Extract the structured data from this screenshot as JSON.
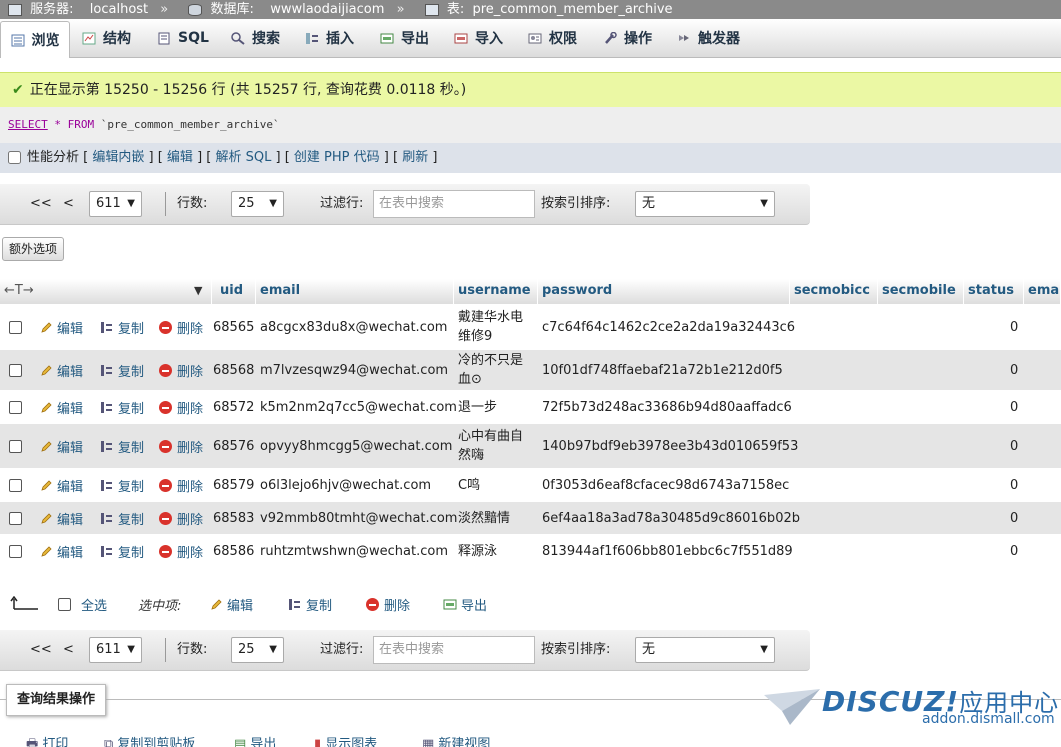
{
  "breadcrumb": {
    "server_label": "服务器:",
    "server": "localhost",
    "db_label": "数据库:",
    "db": "wwwlaodaijiacom",
    "table_label": "表:",
    "table": "pre_common_member_archive",
    "sep": "»"
  },
  "tabs": [
    {
      "label": "浏览",
      "icon": "browse-icon"
    },
    {
      "label": "结构",
      "icon": "structure-icon"
    },
    {
      "label": "SQL",
      "icon": "sql-icon"
    },
    {
      "label": "搜索",
      "icon": "search-icon"
    },
    {
      "label": "插入",
      "icon": "insert-icon"
    },
    {
      "label": "导出",
      "icon": "export-icon"
    },
    {
      "label": "导入",
      "icon": "import-icon"
    },
    {
      "label": "权限",
      "icon": "privileges-icon"
    },
    {
      "label": "操作",
      "icon": "operations-icon"
    },
    {
      "label": "触发器",
      "icon": "triggers-icon"
    }
  ],
  "notice": "正在显示第 15250 - 15256 行 (共 15257 行, 查询花费 0.0118 秒。)",
  "sql": {
    "select": "SELECT",
    "star": "*",
    "from": "FROM",
    "table": "`pre_common_member_archive`"
  },
  "actions": {
    "profiling": "性能分析",
    "edit_inline": "编辑内嵌",
    "edit": "编辑",
    "explain": "解析 SQL",
    "create_php": "创建 PHP 代码",
    "refresh": "刷新"
  },
  "nav": {
    "first": "<<",
    "prev": "<",
    "page": "611",
    "rows_label": "行数:",
    "rows": "25",
    "filter_label": "过滤行:",
    "filter_placeholder": "在表中搜索",
    "sort_label": "按索引排序:",
    "sort": "无"
  },
  "extra_options": "额外选项",
  "columns": [
    "uid",
    "email",
    "username",
    "password",
    "secmobicc",
    "secmobile",
    "status",
    "emai"
  ],
  "row_actions": {
    "edit": "编辑",
    "copy": "复制",
    "delete": "删除"
  },
  "rows": [
    {
      "uid": "68565",
      "email": "a8cgcx83du8x@wechat.com",
      "username": "戴建华水电维修9",
      "password": "c7c64f64c1462c2ce2a2da19a32443c6",
      "status": "0"
    },
    {
      "uid": "68568",
      "email": "m7lvzesqwz94@wechat.com",
      "username": "冷的不只是血⊙",
      "password": "10f01df748ffaebaf21a72b1e212d0f5",
      "status": "0"
    },
    {
      "uid": "68572",
      "email": "k5m2nm2q7cc5@wechat.com",
      "username": "退一步",
      "password": "72f5b73d248ac33686b94d80aaffadc6",
      "status": "0"
    },
    {
      "uid": "68576",
      "email": "opvyy8hmcgg5@wechat.com",
      "username": "心中有曲自然嗨",
      "password": "140b97bdf9eb3978ee3b43d010659f53",
      "status": "0"
    },
    {
      "uid": "68579",
      "email": "o6l3lejo6hjv@wechat.com",
      "username": "C鸣",
      "password": "0f3053d6eaf8cfacec98d6743a7158ec",
      "status": "0"
    },
    {
      "uid": "68583",
      "email": "v92mmb80tmht@wechat.com",
      "username": "淡然黯情",
      "password": "6ef4aa18a3ad78a30485d9c86016b02b",
      "status": "0"
    },
    {
      "uid": "68586",
      "email": "ruhtzmtwshwn@wechat.com",
      "username": "释源泳",
      "password": "813944af1f606bb801ebbc6c7f551d89",
      "status": "0"
    }
  ],
  "footer": {
    "select_all": "全选",
    "with_selected": "选中项:",
    "edit": "编辑",
    "copy": "复制",
    "delete": "删除",
    "export": "导出"
  },
  "result_ops": "查询结果操作",
  "bottom_links": [
    "打印",
    "复制到剪贴板",
    "导出",
    "显示图表",
    "新建视图"
  ],
  "watermark": {
    "logo": "DISCUZ!",
    "cn": "应用中心",
    "sub": "addon.dismall.com"
  },
  "colors": {
    "accent": "#235a81",
    "notice_bg": "#ebf8a4",
    "delete": "#d9322b"
  }
}
